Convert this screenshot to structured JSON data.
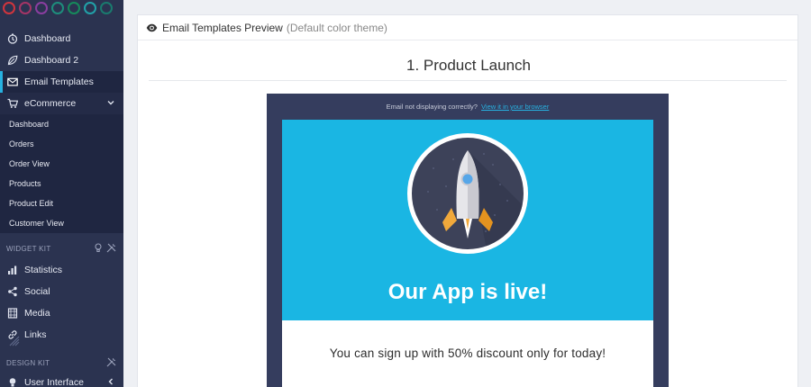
{
  "theme_dots": [
    "#d0353d",
    "#a53566",
    "#8a3ea0",
    "#1e8d7c",
    "#168a5b",
    "#21a1a8",
    "#1a7a6e"
  ],
  "sidebar": {
    "items": [
      {
        "label": "Dashboard",
        "icon": "clock-icon"
      },
      {
        "label": "Dashboard 2",
        "icon": "leaf-icon"
      },
      {
        "label": "Email Templates",
        "icon": "envelope-icon"
      },
      {
        "label": "eCommerce",
        "icon": "cart-icon"
      }
    ],
    "ecommerce_sub": [
      "Dashboard",
      "Orders",
      "Order View",
      "Products",
      "Product Edit",
      "Customer View"
    ],
    "widget_kit": {
      "heading": "WIDGET KIT",
      "items": [
        {
          "label": "Statistics",
          "icon": "bar-chart-icon"
        },
        {
          "label": "Social",
          "icon": "share-icon"
        },
        {
          "label": "Media",
          "icon": "film-icon"
        },
        {
          "label": "Links",
          "icon": "link-icon"
        }
      ]
    },
    "design_kit": {
      "heading": "DESIGN KIT",
      "items": [
        {
          "label": "User Interface",
          "icon": "bulb-icon"
        }
      ]
    }
  },
  "card": {
    "title": "Email Templates Preview",
    "subtitle": "(Default color theme)",
    "template_title": "1. Product Launch"
  },
  "email": {
    "notice_text": "Email not displaying correctly?",
    "notice_link": "View it in your browser",
    "hero_title": "Our App is live!",
    "body_text": "You can sign up with 50% discount only for today!"
  },
  "colors": {
    "sidebar_bg": "#2b3350",
    "accent": "#27b1e0",
    "hero_bg": "#1ab6e3",
    "email_frame": "#353d5e"
  }
}
